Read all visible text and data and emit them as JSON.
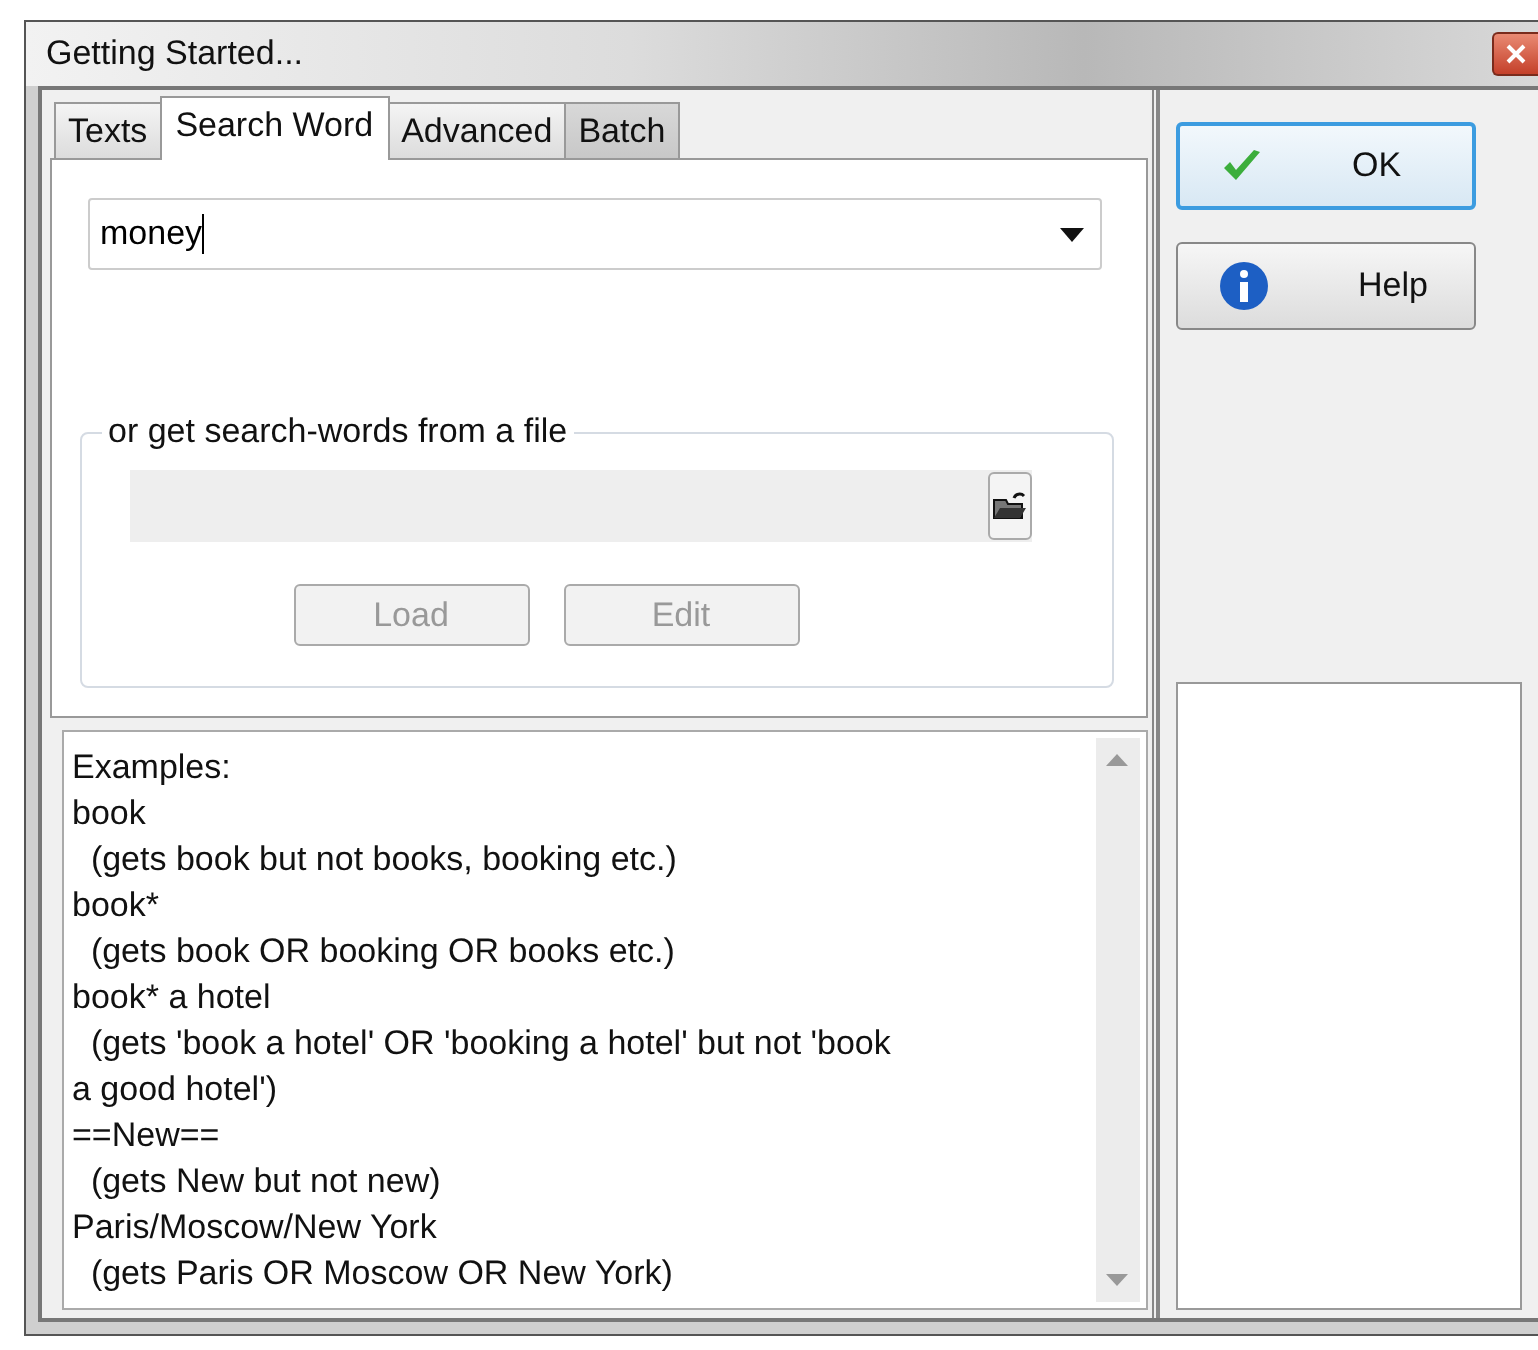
{
  "window": {
    "title": "Getting Started..."
  },
  "tabs": [
    {
      "label": "Texts",
      "selected": false
    },
    {
      "label": "Search Word",
      "selected": true
    },
    {
      "label": "Advanced",
      "selected": false
    },
    {
      "label": "Batch",
      "selected": false
    }
  ],
  "search_word": {
    "value": "money"
  },
  "file_group": {
    "title": "or get search-words from a file",
    "buttons": [
      {
        "label": "Load",
        "disabled": true
      },
      {
        "label": "Edit",
        "disabled": true
      }
    ]
  },
  "examples": [
    "Examples:",
    "book",
    "  (gets book but not books, booking etc.)",
    "book*",
    "  (gets book OR booking OR books etc.)",
    "book* a hotel",
    "  (gets 'book a hotel' OR 'booking a hotel' but not 'book",
    "a good hotel')",
    "==New==",
    "  (gets New but not new)",
    "Paris/Moscow/New York",
    "  (gets Paris OR Moscow OR New York)"
  ],
  "buttons": [
    {
      "kind": "ok",
      "label": "OK"
    },
    {
      "kind": "help",
      "label": "Help"
    }
  ]
}
